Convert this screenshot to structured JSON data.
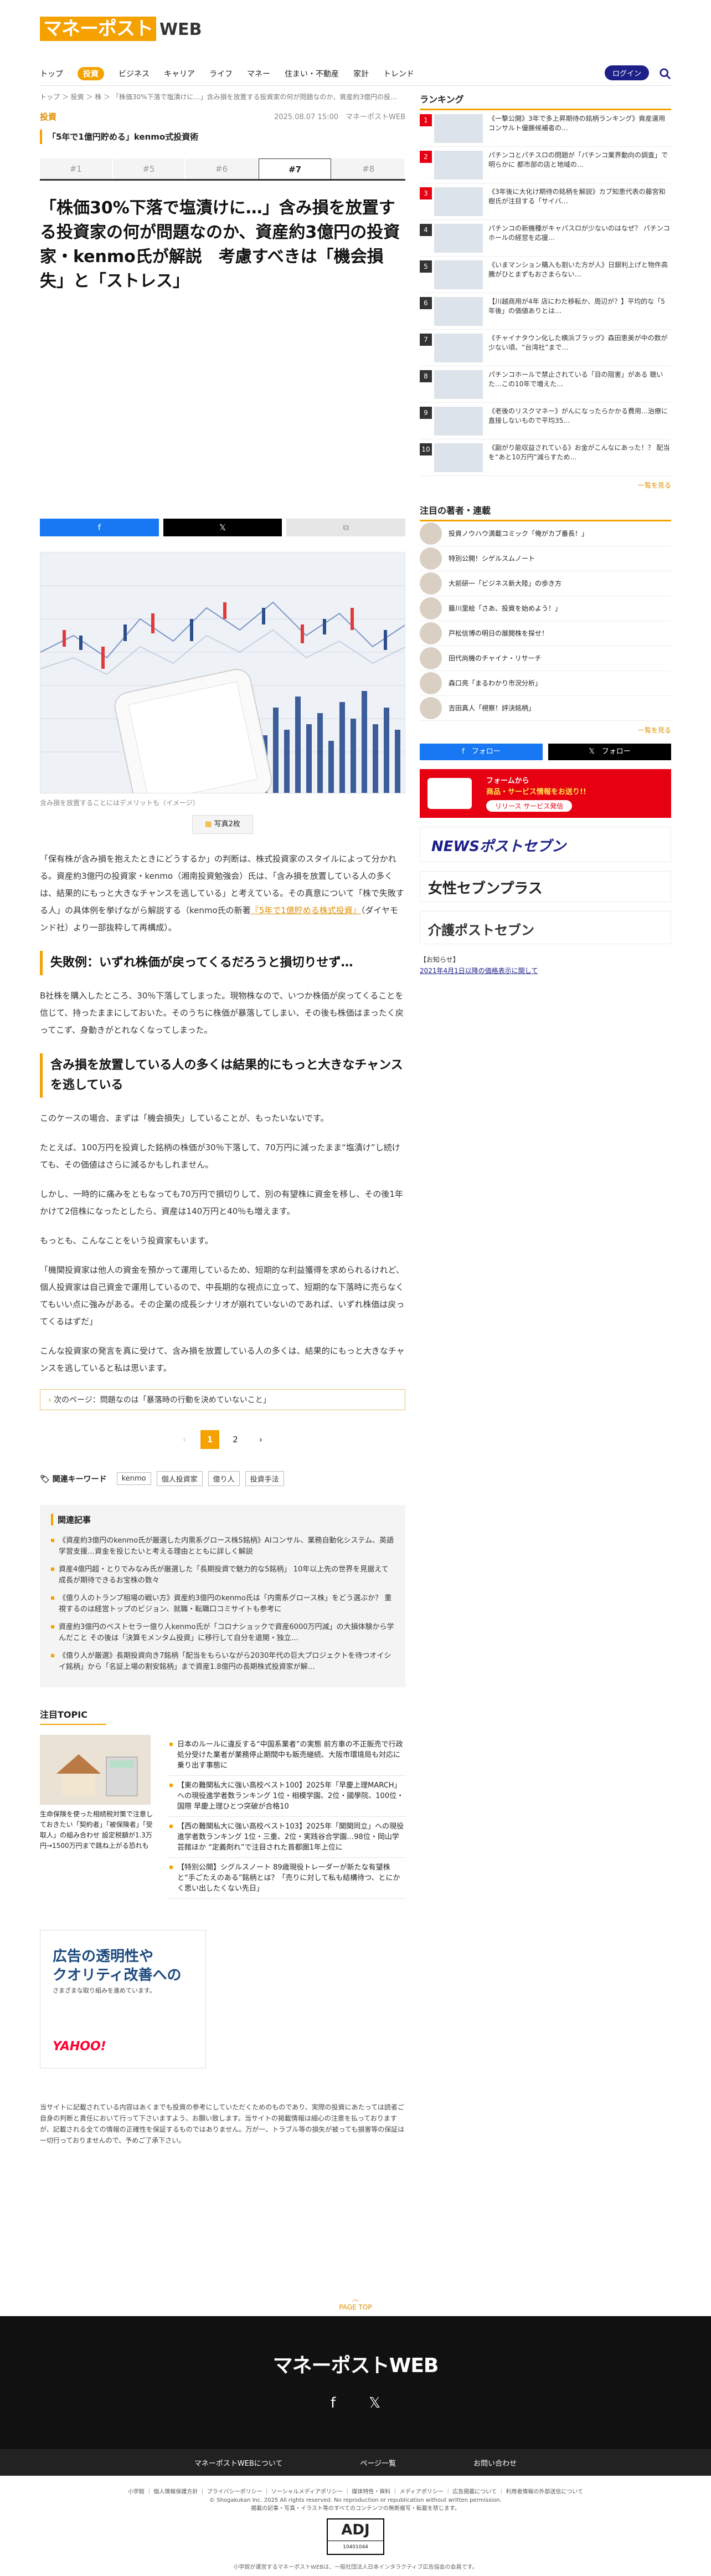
{
  "header": {
    "logo_main": "マネーポスト",
    "logo_sub": "WEB",
    "nav": [
      "トップ",
      "投資",
      "ビジネス",
      "キャリア",
      "ライフ",
      "マネー",
      "住まい・不動産",
      "家計",
      "トレンド"
    ],
    "login": "ログイン"
  },
  "breadcrumb": "トップ ＞ 投資 ＞ 株 ＞ 「株価30%下落で塩漬けに…」含み損を放置する投資家の何が問題なのか、資産約3億円の投...",
  "article": {
    "category": "投資",
    "meta": "2025.08.07 15:00　マネーポストWEB",
    "series": "「5年で1億円貯める」kenmo式投資術",
    "tabs": [
      "#1",
      "#5",
      "#6",
      "#7",
      "#8"
    ],
    "active_tab": "#7",
    "title": "「株価30%下落で塩漬けに…」含み損を放置する投資家の何が問題なのか、資産約3億円の投資家・kenmo氏が解説　考慮すべきは「機会損失」と「ストレス」",
    "share": {
      "facebook": "f",
      "x": "𝕏",
      "copy": "⧉"
    },
    "caption": "含み損を放置することにはデメリットも（イメージ）",
    "photo_btn": "写真2枚",
    "lead_before": "「保有株が含み損を抱えたときにどうするか」の判断は、株式投資家のスタイルによって分かれる。資産約3億円の投資家・kenmo（湘南投資勉強会）氏は、「含み損を放置している人の多くは、結果的にもっと大きなチャンスを逃している」と考えている。その真意について「株で失敗する人」の具体例を挙げながら解説する（kenmo氏の新著",
    "lead_link": "『5年で1億貯める株式投資』",
    "lead_after": "（ダイヤモンド社）より一部抜粋して再構成）。",
    "h2_1": "失敗例：いずれ株価が戻ってくるだろうと損切りせず…",
    "p1": "B社株を購入したところ、30％下落してしまった。現物株なので、いつか株価が戻ってくることを信じて、持ったままにしておいた。そのうちに株価が暴落してしまい、その後も株価はまったく戻ってこず、身動きがとれなくなってしまった。",
    "h2_2": "含み損を放置している人の多くは結果的にもっと大きなチャンスを逃している",
    "p2": "このケースの場合、まずは「機会損失」していることが、もったいないです。",
    "p3": "たとえば、100万円を投資した銘柄の株価が30％下落して、70万円に減ったまま“塩漬け”し続けても、その価値はさらに減るかもしれません。",
    "p4": "しかし、一時的に痛みをともなっても70万円で損切りして、別の有望株に資金を移し、その後1年かけて2倍株になったとしたら、資産は140万円と40％も増えます。",
    "p5": "もっとも、こんなことをいう投資家もいます。",
    "p6": "「機関投資家は他人の資金を預かって運用しているため、短期的な利益獲得を求められるけれど、個人投資家は自己資金で運用しているので、中長期的な視点に立って、短期的な下落時に売らなくてもいい点に強みがある。その企業の成長シナリオが崩れていないのであれば、いずれ株価は戻ってくるはずだ」",
    "p7": "こんな投資家の発言を真に受けて、含み損を放置している人の多くは、結果的にもっと大きなチャンスを逃していると私は思います。",
    "next": "次のページ：問題なのは「暴落時の行動を決めていないこと」",
    "pages": [
      "‹",
      "1",
      "2",
      "›"
    ],
    "keywords_label": "関連キーワード",
    "keywords": [
      "kenmo",
      "個人投資家",
      "億り人",
      "投資手法"
    ]
  },
  "related": {
    "title": "関連記事",
    "items": [
      "《資産約3億円のkenmo氏が厳選した内需系グロース株5銘柄》AIコンサル、業務自動化システム、英語学習支援…資金を投じたいと考える理由とともに詳しく解説",
      "資産4億円超・とりでみなみ氏が厳選した「長期投資で魅力的な5銘柄」 10年以上先の世界を見据えて成長が期待できるお宝株の数々",
      "《億り人のトランプ相場の戦い方》資産約3億円のkenmo氏は「内需系グロース株」をどう選ぶか？ 重視するのは経営トップのビジョン、就職・転職口コミサイトも参考に",
      "資産約3億円のベストセラー億り人kenmo氏が「コロナショックで資産6000万円減」の大損体験から学んだこと その後は「決算モメンタム投資」に移行して自分を道開・独立…",
      "《億り人が厳選》長期投資向き7銘柄「配当をもらいながら2030年代の巨大プロジェクトを待つオイシイ銘柄」から「名証上場の割安銘柄」まで資産1.8億円の長期株式投資家が解…"
    ]
  },
  "topic": {
    "title": "注目TOPIC",
    "caption": "生命保険を使った相続税対策で注意しておきたい「契約者」「被保険者」「受取人」の組み合わせ 設定税額が1.3万円→1500万円まで跳ね上がる恐れも",
    "items": [
      "日本のルールに違反する“中国系業者”の実態 前方車の不正販売で行政処分受けた業者が業務停止期間中も販売継続、大阪市環境局も対応に乗り出す事態に",
      "【東の難関私大に強い高校ベスト100】2025年「早慶上理MARCH」への現役進学者数ランキング 1位・相模学園、2位・國學院、100位・国際 早慶上理ひとつ突破が合格10",
      "【西の難関私大に強い高校ベスト103】2025年「関関同立」への現役進学者数ランキング 1位・三重、2位・実践谷合学園…98位・岡山学芸館ほか “定義剤れ”で注目された首都圏1年上位に",
      "【特別公開】シグルスノート 89歳現役トレーダーが新たな有望株と“手ごたえのある”銘柄とは？「売りに対して私も結構待つ、とにかく思い出したくない先日」"
    ]
  },
  "ad": {
    "line1": "広告の透明性や",
    "line2": "クオリティ改善への",
    "line3": "さまざまな取り組みを進めています。",
    "brand": "YAHOO!"
  },
  "disclaimer": "当サイトに記載されている内容はあくまでも投資の参考にしていただくためのものであり、実際の投資にあたっては読者ご自身の判断と責任において行って下さいますよう、お願い致します。当サイトの掲載情報は細心の注意を払っておりますが、記載される全ての情報の正確性を保証するものではありません。万が一、トラブル等の損失が被っても損害等の保証は一切行っておりませんので、予めご了承下さい。",
  "sidebar": {
    "ranking_title": "ランキング",
    "ranking": [
      "《一撃公開》3年で多上昇期待の銘柄ランキング》資産運用コンサルト優勝候補者の…",
      "パチンコとパチスロの問題が「パチンコ業界動向の調査」で明らかに 都市部の店と地域の…",
      "《3年後に大化け期待の銘柄を解説》カブ知恵代表の藤宮和樹氏が注目する「サイバ…",
      "パチンコの新機種がキャパスロが少ないのはなぜ？ パチンコホールの経営を応援…",
      "《いまマンション購入も割いた方が人》日銀利上げと物件高騰がひとまずもおさまらない…",
      "【川越商用が4年 店にわた移転か、周辺が？】平均的な「5年後」の価値ありとは…",
      "《チャイナタウン化した横浜ブラッグ》森田恵美が中の数が少ない頃、“台湾社”まで…",
      "パチンコホールで禁止されている「目の阻害」がある 聴いた…この10年で増えた…",
      "《老後のリスクマネー》がんになったらかかる費用…治療に直接しないもので平均35…",
      "《副がり能収益されている》お金がこんなにあった！？ 配当を“あと10万円”減らすため…"
    ],
    "more": "一覧を見る",
    "authors_title": "注目の著者・連載",
    "authors": [
      "投資ノウハウ満載コミック「俺がカブ番長！」",
      "特別公開！シゲルスムノート",
      "大前研一「ビジネス新大陸」の歩き方",
      "藤川里絵「さあ、投資を始めよう！」",
      "戸松信博の明日の展開株を探せ！",
      "田代尚機のチャイナ・リサーチ",
      "森口亮「まるわかり市況分析」",
      "吉田真人「視察！評決銘柄」"
    ],
    "authors_more": "一覧を見る",
    "follow_fb": "f　フォロー",
    "follow_x": "𝕏　フォロー",
    "banner1_title": "フォームから",
    "banner1_sub": "商品・サービス情報をお送り!!",
    "banner1_btn": "リリース サービス発信",
    "banner2": "NEWSポストセブン",
    "banner3": "女性セブンプラス",
    "banner4": "介護ポストセブン",
    "notice_title": "【お知らせ】",
    "notice_text": "2021年4月1日以降の価格表示に関して"
  },
  "footer": {
    "pagetop": "PAGE TOP",
    "logo": "マネーポストWEB",
    "links": [
      "マネーポストWEBについて",
      "ページ一覧",
      "お問い合わせ"
    ],
    "copy1": "小学館 ｜ 個人情報保護方針 ｜ プライバシーポリシー ｜ ソーシャルメディアポリシー ｜ 媒体特性・資料 ｜ メディアポリシー ｜ 広告掲載について ｜ 利用者情報の外部送信について",
    "copy2": "© Shogakukan Inc. 2025 All rights reserved. No reproduction or republication without written permission.",
    "copy3": "掲載の記事・写真・イラスト等のすべてのコンテンツの無断複写・転載を禁じます。",
    "adj_logo": "ADJ",
    "adj_num": "10401044",
    "bottom": "小学館が運営するマネーポストWEBは、一般社団法人日本インタラクティブ広告協会の会員です。"
  }
}
